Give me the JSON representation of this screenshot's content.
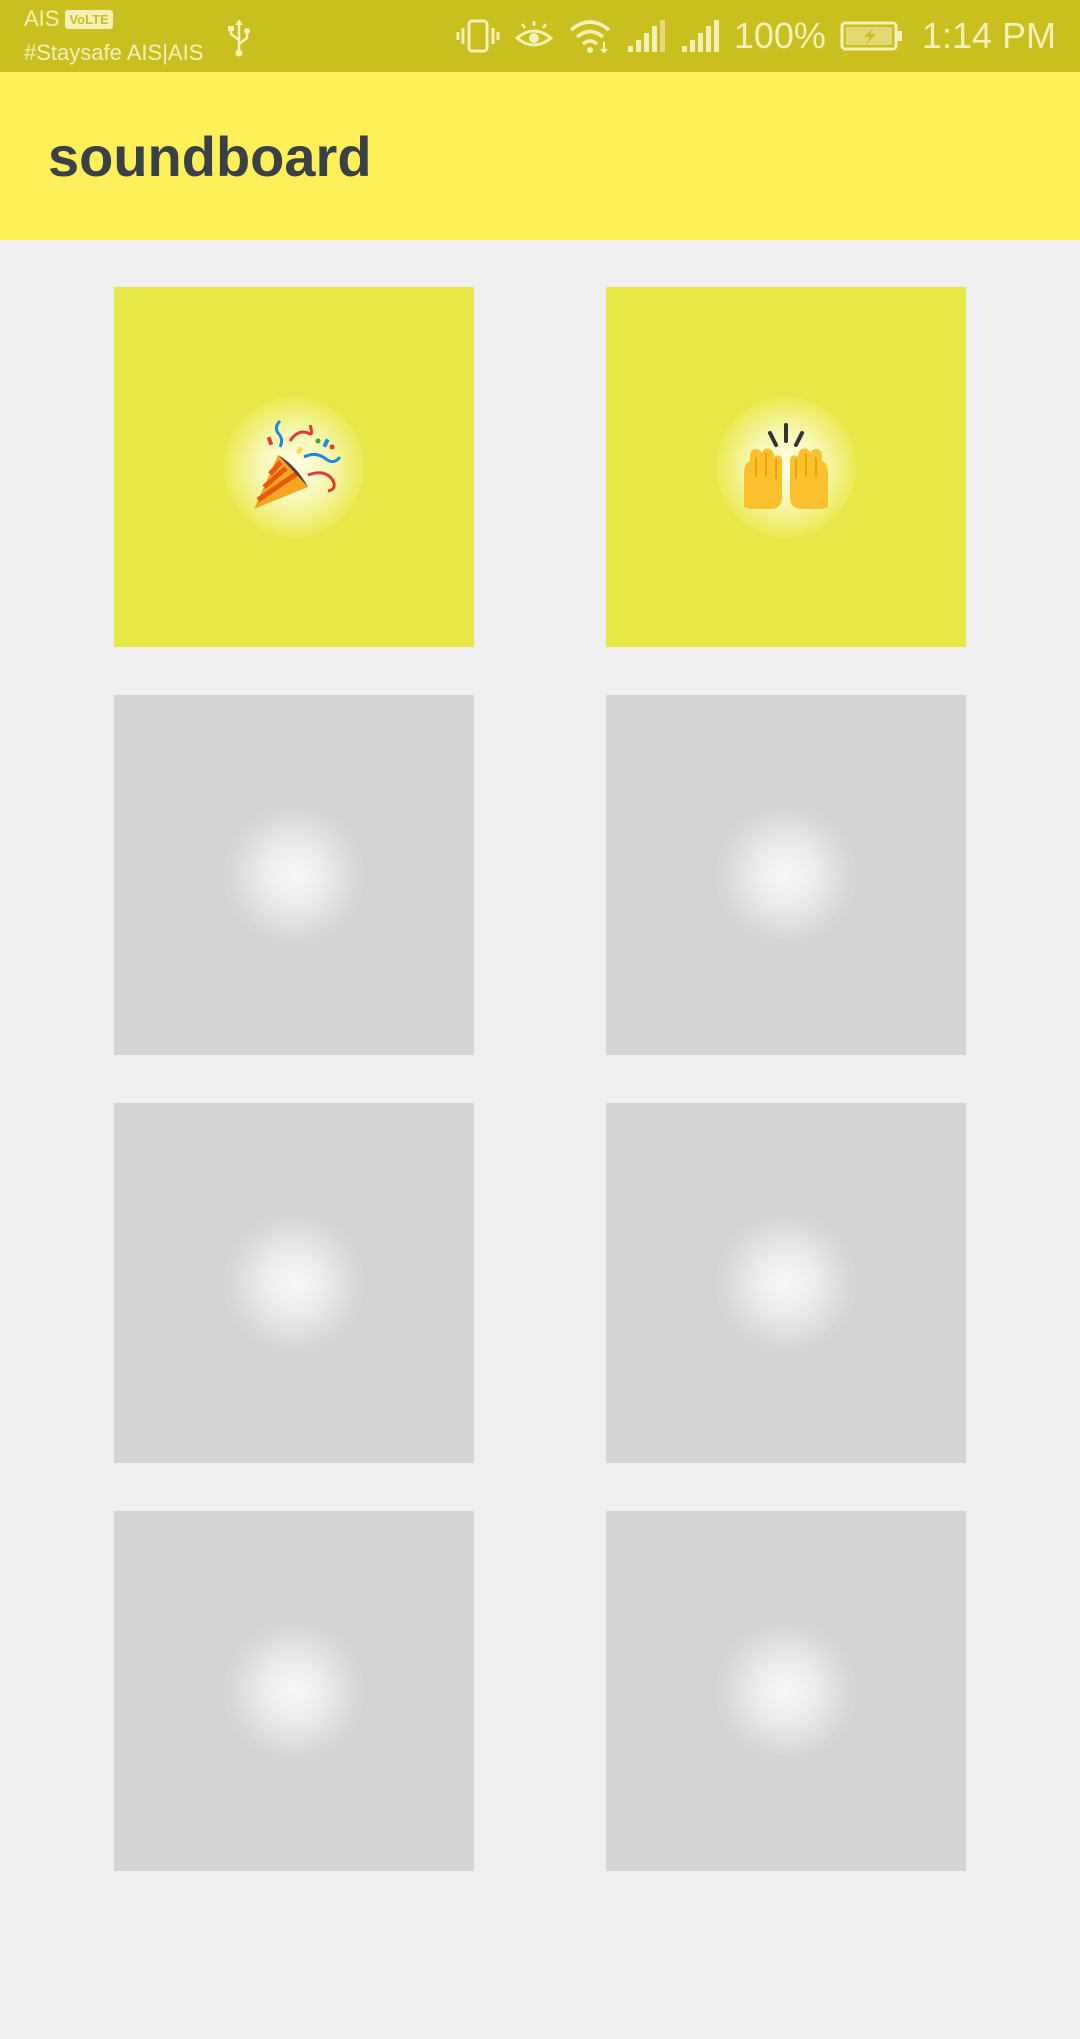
{
  "status_bar": {
    "carrier": "AIS",
    "volte_badge": "VoLTE",
    "carrier_sub": "#Staysafe AIS|AIS",
    "battery_percent": "100%",
    "time": "1:14 PM",
    "icons": [
      "usb-icon",
      "vibrate-icon",
      "eye-comfort-icon",
      "wifi-icon",
      "signal-1-icon",
      "signal-2-icon",
      "battery-charging-icon"
    ]
  },
  "app_bar": {
    "title": "soundboard",
    "background": "#fff05a"
  },
  "grid": {
    "tiles": [
      {
        "icon": "party-popper-icon",
        "state": "active"
      },
      {
        "icon": "raising-hands-icon",
        "state": "active"
      },
      {
        "icon": "",
        "state": "empty"
      },
      {
        "icon": "",
        "state": "empty"
      },
      {
        "icon": "",
        "state": "empty"
      },
      {
        "icon": "",
        "state": "empty"
      },
      {
        "icon": "",
        "state": "empty"
      },
      {
        "icon": "",
        "state": "empty"
      }
    ],
    "active_color": "#e7e847",
    "empty_color": "#d4d4d4"
  }
}
